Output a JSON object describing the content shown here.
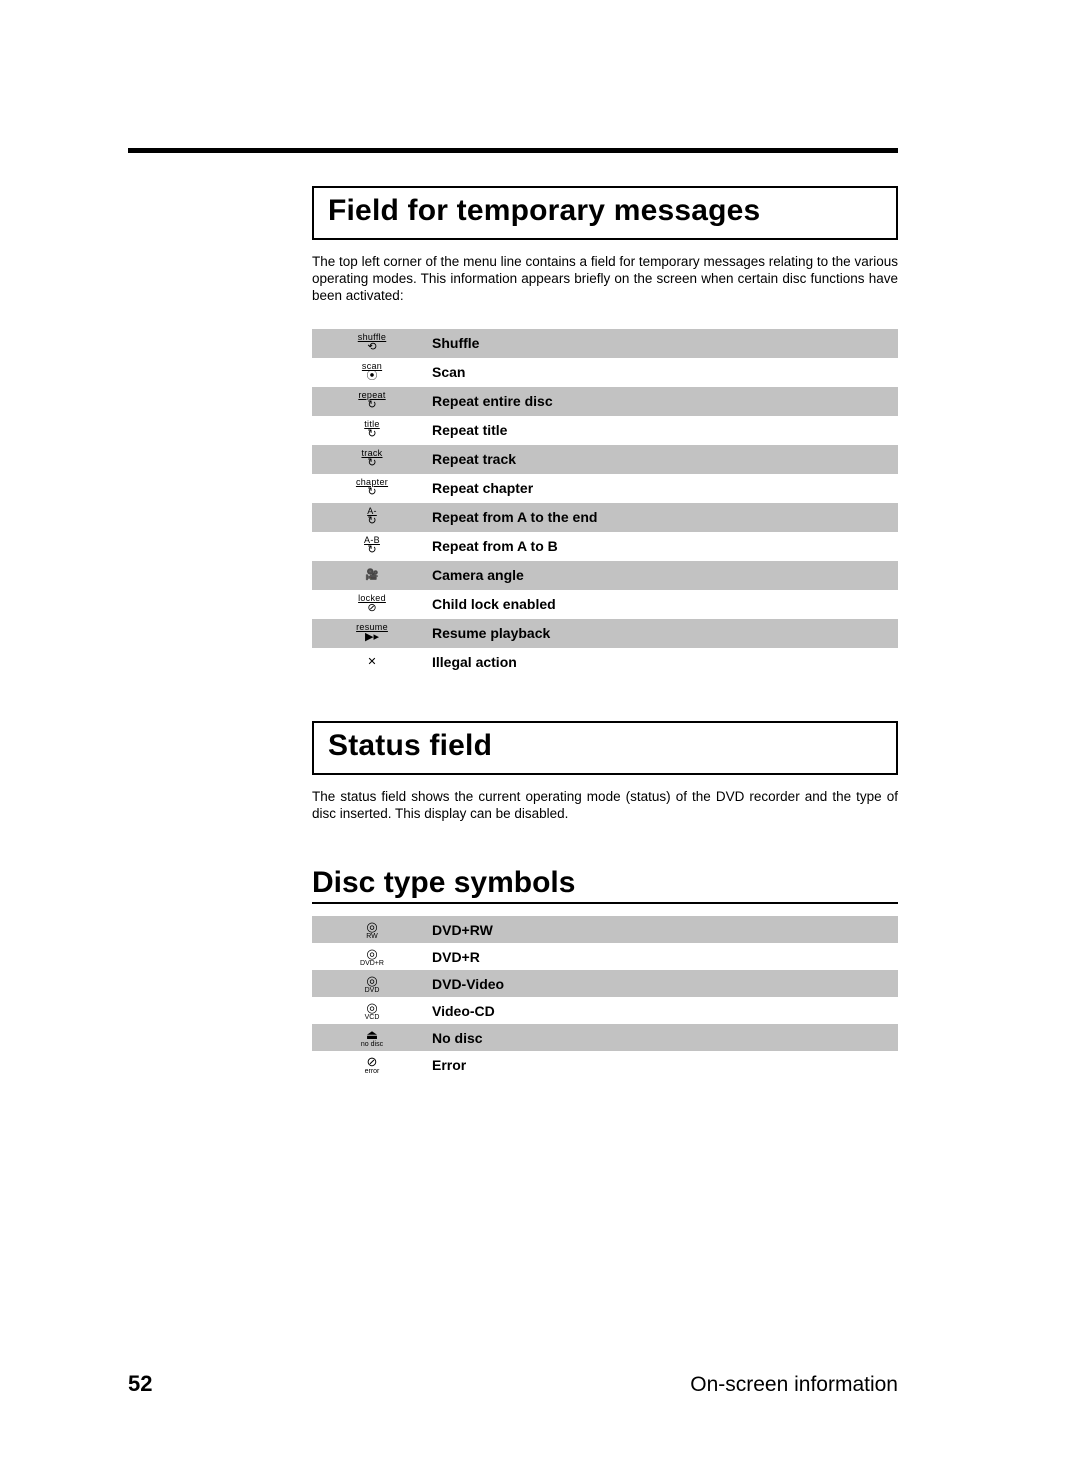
{
  "section1": {
    "heading": "Field for temporary messages",
    "body": "The top left corner of the menu line contains a field for temporary messages relating to the various operating modes. This information appears briefly on the screen when certain disc functions have been activated:",
    "rows": [
      {
        "icon_cap": "shuffle",
        "icon_glyph": "⟲",
        "label": "Shuffle"
      },
      {
        "icon_cap": "scan",
        "icon_glyph": "⦿",
        "label": "Scan"
      },
      {
        "icon_cap": "repeat",
        "icon_glyph": "↻",
        "label": "Repeat entire disc"
      },
      {
        "icon_cap": "title",
        "icon_glyph": "↻",
        "label": "Repeat title"
      },
      {
        "icon_cap": "track",
        "icon_glyph": "↻",
        "label": "Repeat track"
      },
      {
        "icon_cap": "chapter",
        "icon_glyph": "↻",
        "label": "Repeat chapter"
      },
      {
        "icon_cap": "A-",
        "icon_glyph": "↻",
        "label": "Repeat from A to the end"
      },
      {
        "icon_cap": "A-B",
        "icon_glyph": "↻",
        "label": "Repeat from A to B"
      },
      {
        "icon_cap": "",
        "icon_glyph": "🎥",
        "label": "Camera angle"
      },
      {
        "icon_cap": "locked",
        "icon_glyph": "⊘",
        "label": "Child lock enabled"
      },
      {
        "icon_cap": "resume",
        "icon_glyph": "▶▸",
        "label": "Resume playback"
      },
      {
        "icon_cap": "",
        "icon_glyph": "✕",
        "label": "Illegal action"
      }
    ]
  },
  "section2": {
    "heading": "Status field",
    "body": "The status field shows the current operating mode (status) of the DVD recorder and the type of disc inserted. This display can be disabled."
  },
  "section3": {
    "heading": "Disc type symbols",
    "rows": [
      {
        "icon_glyph": "◎",
        "icon_cap": "RW",
        "label": "DVD+RW"
      },
      {
        "icon_glyph": "◎",
        "icon_cap": "DVD+R",
        "label": "DVD+R"
      },
      {
        "icon_glyph": "◎",
        "icon_cap": "DVD",
        "label": "DVD-Video"
      },
      {
        "icon_glyph": "◎",
        "icon_cap": "VCD",
        "label": "Video-CD"
      },
      {
        "icon_glyph": "⏏",
        "icon_cap": "no disc",
        "label": "No disc"
      },
      {
        "icon_glyph": "⊘",
        "icon_cap": "error",
        "label": "Error"
      }
    ]
  },
  "footer": {
    "page": "52",
    "title": "On-screen information"
  }
}
